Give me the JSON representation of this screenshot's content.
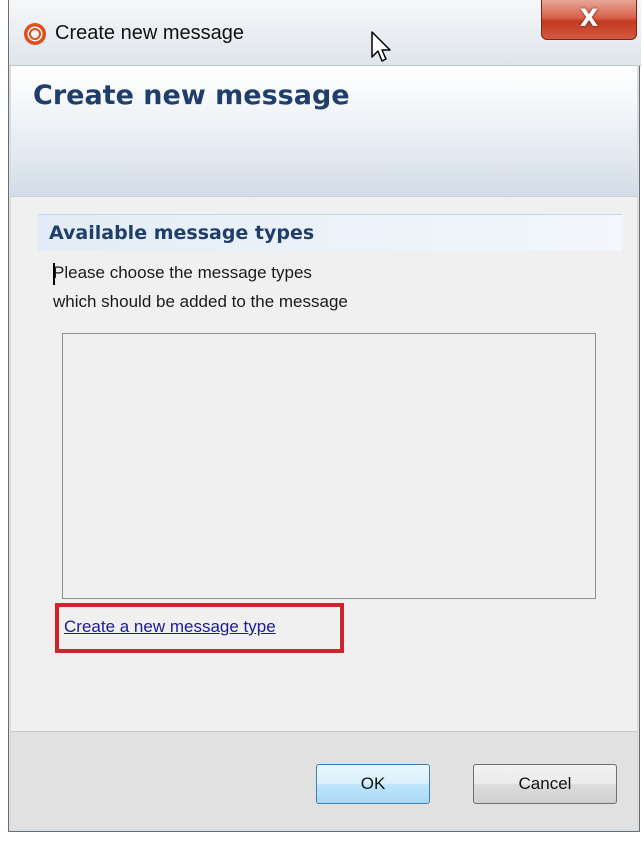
{
  "window": {
    "title": "Create new message",
    "close_label": "X"
  },
  "header": {
    "title": "Create new message"
  },
  "section": {
    "title": "Available message types",
    "description_line1": "Please choose the message types",
    "description_line2": "which should be added to the message"
  },
  "message_types_list": {
    "items": []
  },
  "link": {
    "label": "Create a new message type"
  },
  "buttons": {
    "ok_label": "OK",
    "cancel_label": "Cancel"
  },
  "icons": {
    "app": "app-logo-icon",
    "cursor": "mouse-cursor-icon",
    "close": "close-icon"
  },
  "colors": {
    "header_title": "#1f3e6c",
    "link": "#1a1aa6",
    "highlight_frame": "#d2232a",
    "close_button": "#c23a22"
  }
}
